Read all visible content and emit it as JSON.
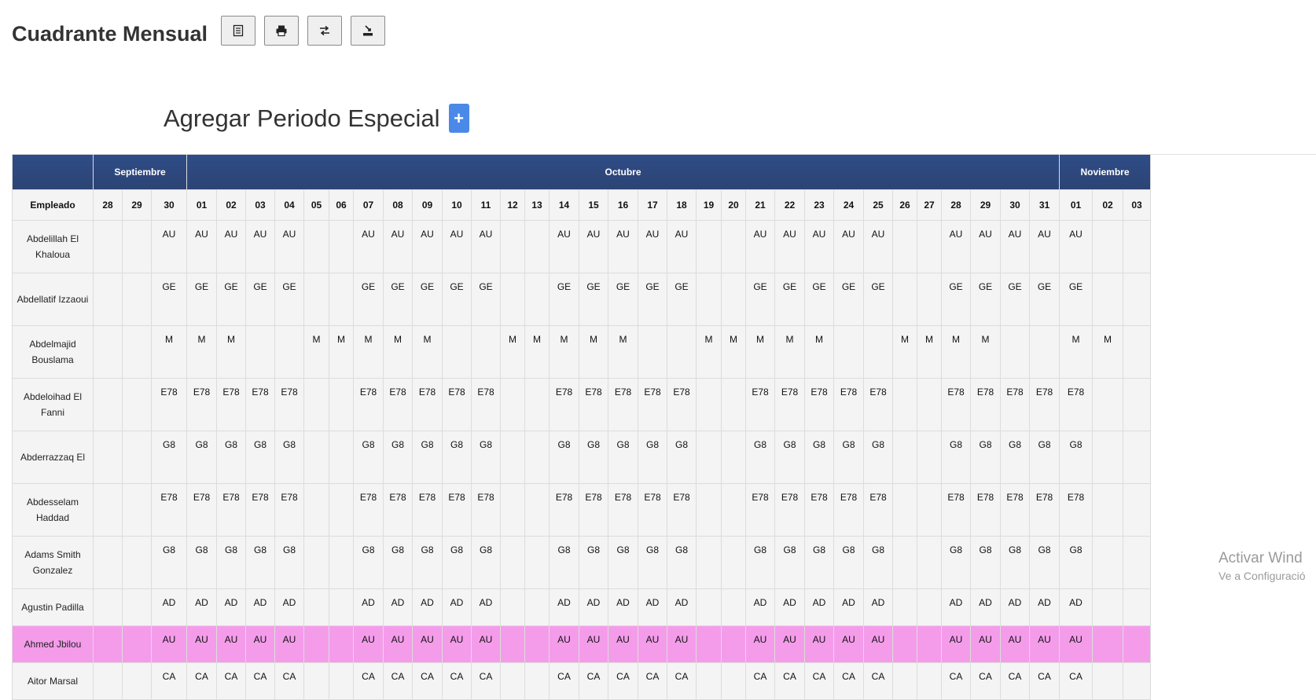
{
  "page": {
    "title": "Cuadrante Mensual"
  },
  "toolbar": {
    "buttons": [
      {
        "name": "list-view-button",
        "icon": "list-icon"
      },
      {
        "name": "print-button",
        "icon": "printer-icon"
      },
      {
        "name": "swap-button",
        "icon": "swap-arrows-icon"
      },
      {
        "name": "export-button",
        "icon": "download-icon"
      }
    ]
  },
  "special_period": {
    "title": "Agregar Periodo Especial",
    "add_label": "+"
  },
  "table": {
    "employee_header": "Empleado",
    "months": [
      {
        "label": "Septiembre",
        "span": 3
      },
      {
        "label": "Octubre",
        "span": 31
      },
      {
        "label": "Noviembre",
        "span": 3
      }
    ],
    "days": [
      "28",
      "29",
      "30",
      "01",
      "02",
      "03",
      "04",
      "05",
      "06",
      "07",
      "08",
      "09",
      "10",
      "11",
      "12",
      "13",
      "14",
      "15",
      "16",
      "17",
      "18",
      "19",
      "20",
      "21",
      "22",
      "23",
      "24",
      "25",
      "26",
      "27",
      "28",
      "29",
      "30",
      "31",
      "01",
      "02",
      "03"
    ],
    "rows": [
      {
        "name": "Abdelillah El Khaloua",
        "cells": [
          "",
          "",
          "AU",
          "AU",
          "AU",
          "AU",
          "AU",
          "",
          "",
          "AU",
          "AU",
          "AU",
          "AU",
          "AU",
          "",
          "",
          "AU",
          "AU",
          "AU",
          "AU",
          "AU",
          "",
          "",
          "AU",
          "AU",
          "AU",
          "AU",
          "AU",
          "",
          "",
          "AU",
          "AU",
          "AU",
          "AU",
          "AU",
          "",
          ""
        ]
      },
      {
        "name": "Abdellatif Izzaoui",
        "cells": [
          "",
          "",
          "GE",
          "GE",
          "GE",
          "GE",
          "GE",
          "",
          "",
          "GE",
          "GE",
          "GE",
          "GE",
          "GE",
          "",
          "",
          "GE",
          "GE",
          "GE",
          "GE",
          "GE",
          "",
          "",
          "GE",
          "GE",
          "GE",
          "GE",
          "GE",
          "",
          "",
          "GE",
          "GE",
          "GE",
          "GE",
          "GE",
          "",
          ""
        ]
      },
      {
        "name": "Abdelmajid Bouslama",
        "cells": [
          "",
          "",
          "M",
          "M",
          "M",
          "",
          "",
          "M",
          "M",
          "M",
          "M",
          "M",
          "",
          "",
          "M",
          "M",
          "M",
          "M",
          "M",
          "",
          "",
          "M",
          "M",
          "M",
          "M",
          "M",
          "",
          "",
          "M",
          "M",
          "M",
          "M",
          "",
          "",
          "M",
          "M",
          ""
        ]
      },
      {
        "name": "Abdeloihad El Fanni",
        "cells": [
          "",
          "",
          "E78",
          "E78",
          "E78",
          "E78",
          "E78",
          "",
          "",
          "E78",
          "E78",
          "E78",
          "E78",
          "E78",
          "",
          "",
          "E78",
          "E78",
          "E78",
          "E78",
          "E78",
          "",
          "",
          "E78",
          "E78",
          "E78",
          "E78",
          "E78",
          "",
          "",
          "E78",
          "E78",
          "E78",
          "E78",
          "E78",
          "",
          ""
        ]
      },
      {
        "name": "Abderrazzaq El",
        "cells": [
          "",
          "",
          "G8",
          "G8",
          "G8",
          "G8",
          "G8",
          "",
          "",
          "G8",
          "G8",
          "G8",
          "G8",
          "G8",
          "",
          "",
          "G8",
          "G8",
          "G8",
          "G8",
          "G8",
          "",
          "",
          "G8",
          "G8",
          "G8",
          "G8",
          "G8",
          "",
          "",
          "G8",
          "G8",
          "G8",
          "G8",
          "G8",
          "",
          ""
        ]
      },
      {
        "name": "Abdesselam Haddad",
        "cells": [
          "",
          "",
          "E78",
          "E78",
          "E78",
          "E78",
          "E78",
          "",
          "",
          "E78",
          "E78",
          "E78",
          "E78",
          "E78",
          "",
          "",
          "E78",
          "E78",
          "E78",
          "E78",
          "E78",
          "",
          "",
          "E78",
          "E78",
          "E78",
          "E78",
          "E78",
          "",
          "",
          "E78",
          "E78",
          "E78",
          "E78",
          "E78",
          "",
          ""
        ]
      },
      {
        "name": "Adams Smith Gonzalez",
        "cells": [
          "",
          "",
          "G8",
          "G8",
          "G8",
          "G8",
          "G8",
          "",
          "",
          "G8",
          "G8",
          "G8",
          "G8",
          "G8",
          "",
          "",
          "G8",
          "G8",
          "G8",
          "G8",
          "G8",
          "",
          "",
          "G8",
          "G8",
          "G8",
          "G8",
          "G8",
          "",
          "",
          "G8",
          "G8",
          "G8",
          "G8",
          "G8",
          "",
          ""
        ]
      },
      {
        "name": "Agustin Padilla",
        "short": true,
        "cells": [
          "",
          "",
          "AD",
          "AD",
          "AD",
          "AD",
          "AD",
          "",
          "",
          "AD",
          "AD",
          "AD",
          "AD",
          "AD",
          "",
          "",
          "AD",
          "AD",
          "AD",
          "AD",
          "AD",
          "",
          "",
          "AD",
          "AD",
          "AD",
          "AD",
          "AD",
          "",
          "",
          "AD",
          "AD",
          "AD",
          "AD",
          "AD",
          "",
          ""
        ]
      },
      {
        "name": "Ahmed Jbilou",
        "short": true,
        "highlight": true,
        "cells": [
          "",
          "",
          "AU",
          "AU",
          "AU",
          "AU",
          "AU",
          "",
          "",
          "AU",
          "AU",
          "AU",
          "AU",
          "AU",
          "",
          "",
          "AU",
          "AU",
          "AU",
          "AU",
          "AU",
          "",
          "",
          "AU",
          "AU",
          "AU",
          "AU",
          "AU",
          "",
          "",
          "AU",
          "AU",
          "AU",
          "AU",
          "AU",
          "",
          ""
        ]
      },
      {
        "name": "Aitor Marsal",
        "short": true,
        "cells": [
          "",
          "",
          "CA",
          "CA",
          "CA",
          "CA",
          "CA",
          "",
          "",
          "CA",
          "CA",
          "CA",
          "CA",
          "CA",
          "",
          "",
          "CA",
          "CA",
          "CA",
          "CA",
          "CA",
          "",
          "",
          "CA",
          "CA",
          "CA",
          "CA",
          "CA",
          "",
          "",
          "CA",
          "CA",
          "CA",
          "CA",
          "CA",
          "",
          ""
        ]
      }
    ],
    "highlight_color": "#f49cea",
    "header_color": "#2c4474"
  },
  "watermark": {
    "line1": "Activar Wind",
    "line2": "Ve a Configuració"
  }
}
